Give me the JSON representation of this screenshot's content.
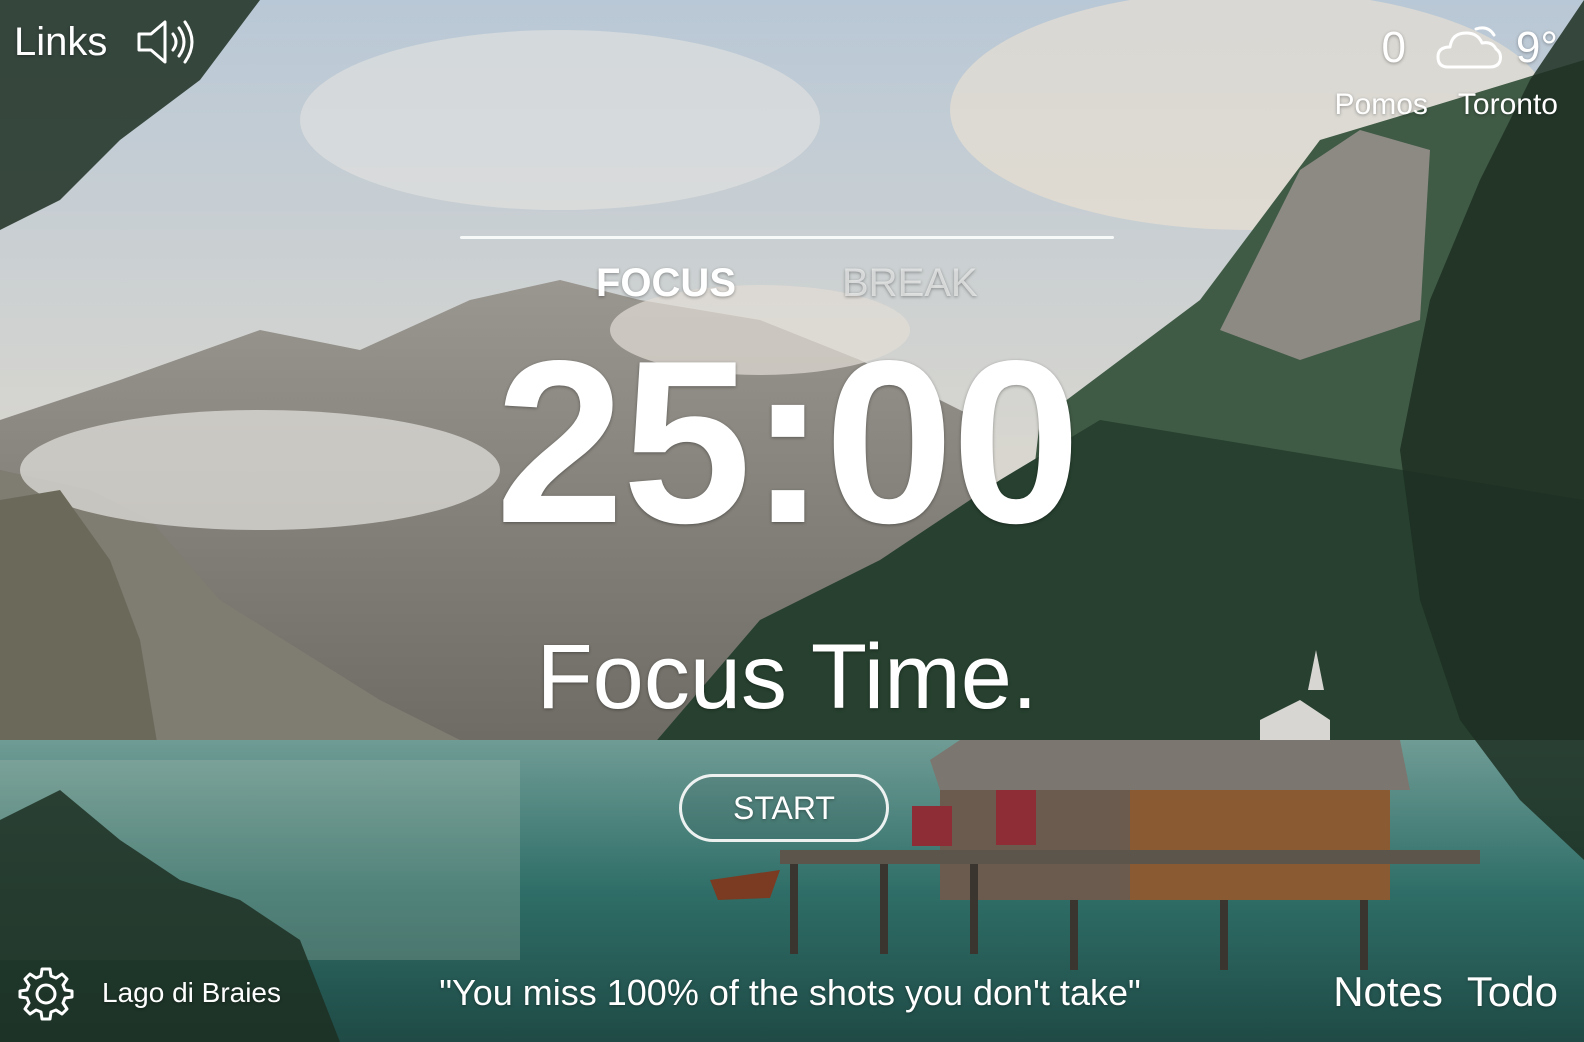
{
  "header": {
    "links_label": "Links",
    "sound_icon": "speaker-volume-icon",
    "pomo_count": "0",
    "weather_icon": "cloud-icon",
    "temperature": "9°",
    "pomos_label": "Pomos",
    "city": "Toronto"
  },
  "timer": {
    "tabs": [
      "FOCUS",
      "BREAK"
    ],
    "active_tab": "FOCUS",
    "time": "25:00",
    "status": "Focus Time.",
    "start_label": "START"
  },
  "footer": {
    "settings_icon": "gear-icon",
    "location": "Lago di Braies",
    "quote": "\"You miss 100% of the shots you don't take\"",
    "notes_label": "Notes",
    "todo_label": "Todo"
  },
  "colors": {
    "text": "#ffffff",
    "inactive_tab": "rgba(255,255,255,0.6)"
  }
}
